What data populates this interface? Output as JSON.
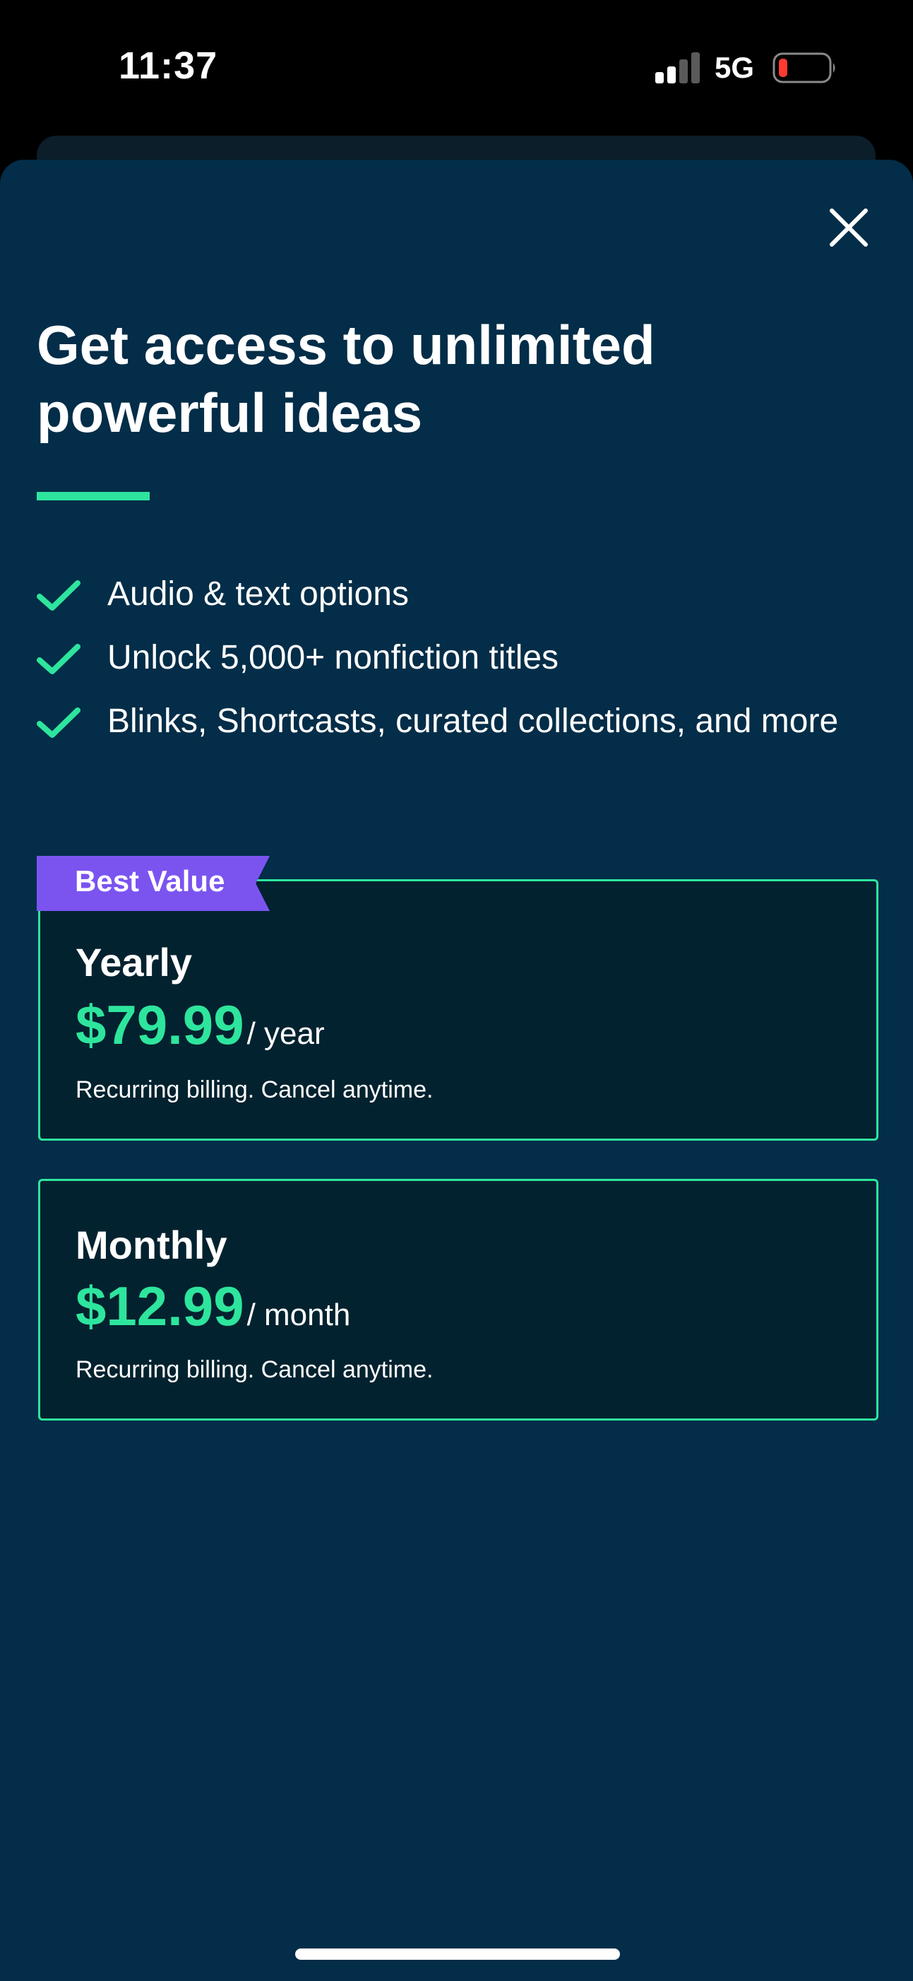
{
  "status_bar": {
    "time": "11:37",
    "network": "5G",
    "icons": [
      "signal-icon",
      "battery-low-icon"
    ]
  },
  "paywall": {
    "close_icon": "close-icon",
    "headline": "Get access to unlimited powerful ideas",
    "features": [
      {
        "icon": "check-icon",
        "label": "Audio & text options"
      },
      {
        "icon": "check-icon",
        "label": "Unlock 5,000+ nonfiction titles"
      },
      {
        "icon": "check-icon",
        "label": "Blinks, Shortcasts, curated collections, and more"
      }
    ],
    "plans": {
      "yearly": {
        "badge": "Best Value",
        "name": "Yearly",
        "price": "$79.99",
        "period": "/ year",
        "note": "Recurring billing. Cancel anytime."
      },
      "monthly": {
        "name": "Monthly",
        "price": "$12.99",
        "period": "/ month",
        "note": "Recurring billing. Cancel anytime."
      }
    }
  },
  "colors": {
    "sheet_background": "#032d48",
    "card_background": "#03222f",
    "accent_green": "#2ee59d",
    "badge_purple": "#7b54f0",
    "battery_low_red": "#ff3b30"
  }
}
